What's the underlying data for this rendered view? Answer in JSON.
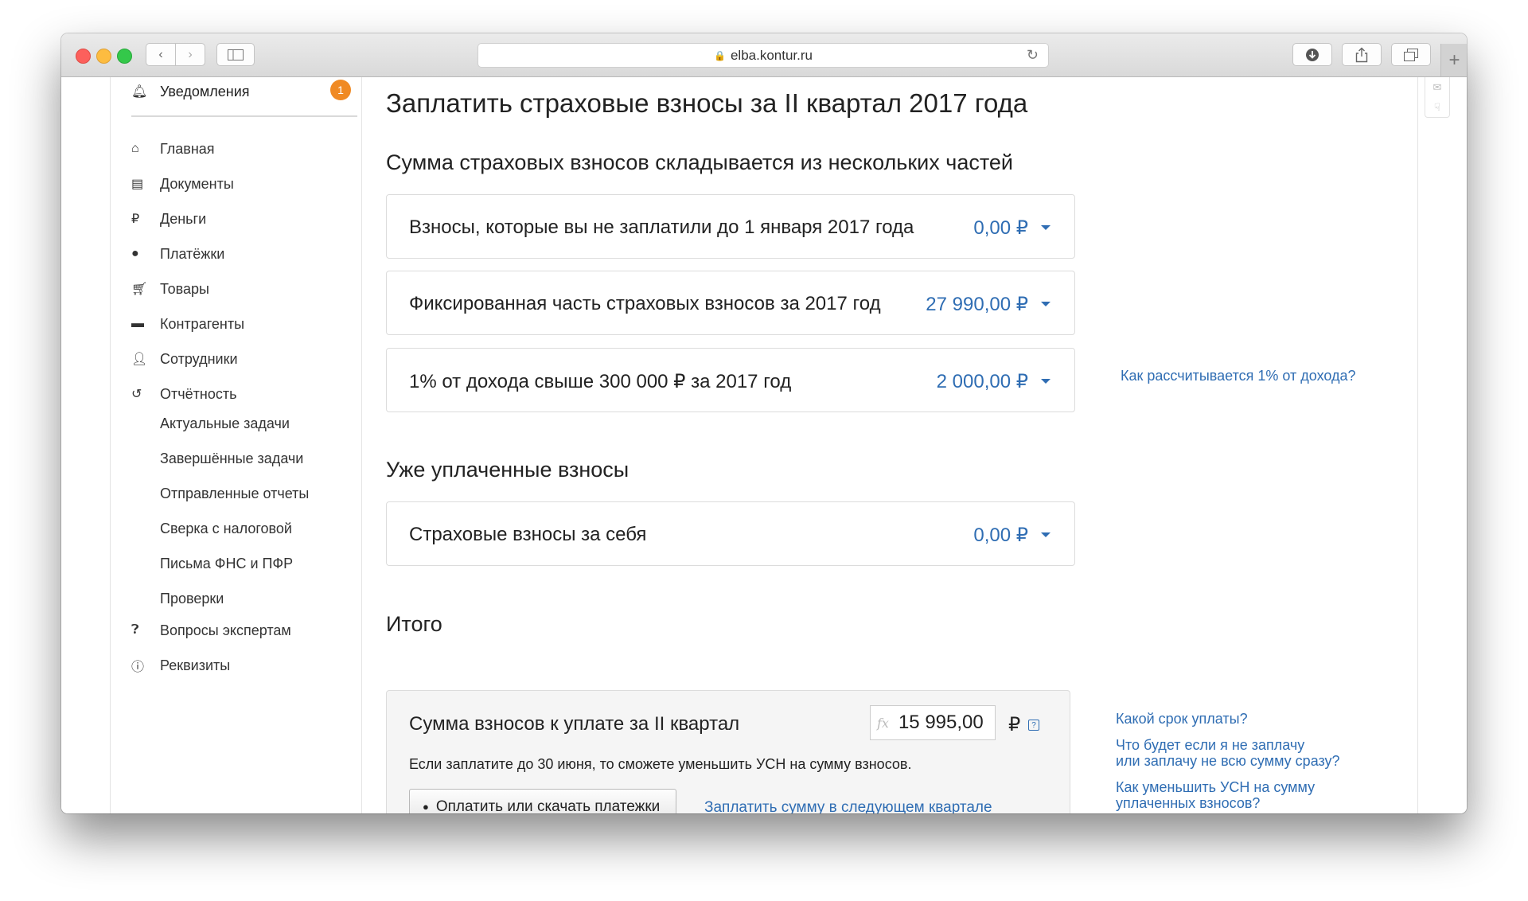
{
  "browser": {
    "url": "elba.kontur.ru"
  },
  "sidebar": {
    "notifications": {
      "label": "Уведомления",
      "count": "1"
    },
    "items": [
      {
        "label": "Главная",
        "icon": "home-icon"
      },
      {
        "label": "Документы",
        "icon": "document-icon"
      },
      {
        "label": "Деньги",
        "icon": "money-icon"
      },
      {
        "label": "Платёжки",
        "icon": "payment-icon"
      },
      {
        "label": "Товары",
        "icon": "cart-icon"
      },
      {
        "label": "Контрагенты",
        "icon": "briefcase-icon"
      },
      {
        "label": "Сотрудники",
        "icon": "person-icon"
      },
      {
        "label": "Отчётность",
        "icon": "report-icon"
      }
    ],
    "subitems": [
      "Актуальные задачи",
      "Завершённые задачи",
      "Отправленные отчеты",
      "Сверка с налоговой",
      "Письма ФНС и ПФР",
      "Проверки"
    ],
    "bottom_items": [
      {
        "label": "Вопросы экспертам",
        "icon": "question-icon"
      },
      {
        "label": "Реквизиты",
        "icon": "info-icon"
      }
    ]
  },
  "main": {
    "title": "Заплатить страховые взносы за II квартал 2017 года",
    "parts_heading": "Сумма страховых взносов складывается из нескольких частей",
    "parts": [
      {
        "label": "Взносы, которые вы не заплатили до 1 января 2017 года",
        "value": "0,00 ₽"
      },
      {
        "label": "Фиксированная часть страховых взносов за 2017 год",
        "value": "27 990,00 ₽"
      },
      {
        "label": "1% от дохода свыше 300 000 ₽ за 2017 год",
        "value": "2 000,00 ₽"
      }
    ],
    "percent_help_link": "Как рассчитывается 1% от дохода?",
    "paid_heading": "Уже уплаченные взносы",
    "paid": {
      "label": "Страховые взносы за себя",
      "value": "0,00 ₽"
    },
    "total_heading": "Итого",
    "total": {
      "label": "Сумма взносов к уплате за II квартал",
      "amount": "15 995,00",
      "currency": "₽",
      "fx_label": "fx",
      "note": "Если заплатите до 30 июня, то сможете уменьшить УСН на сумму взносов.",
      "pay_button": "Оплатить или скачать платежки",
      "next_quarter_link": "Заплатить сумму в следующем квартале"
    },
    "help_links": {
      "deadline": "Какой срок уплаты?",
      "not_pay_line1": "Что будет если я не заплачу",
      "not_pay_line2": "или заплачу не всю сумму сразу?",
      "reduce_line1": "Как уменьшить УСН на сумму",
      "reduce_line2": "уплаченных взносов?"
    }
  },
  "colors": {
    "link": "#2f6db3",
    "badge": "#f08a24"
  }
}
